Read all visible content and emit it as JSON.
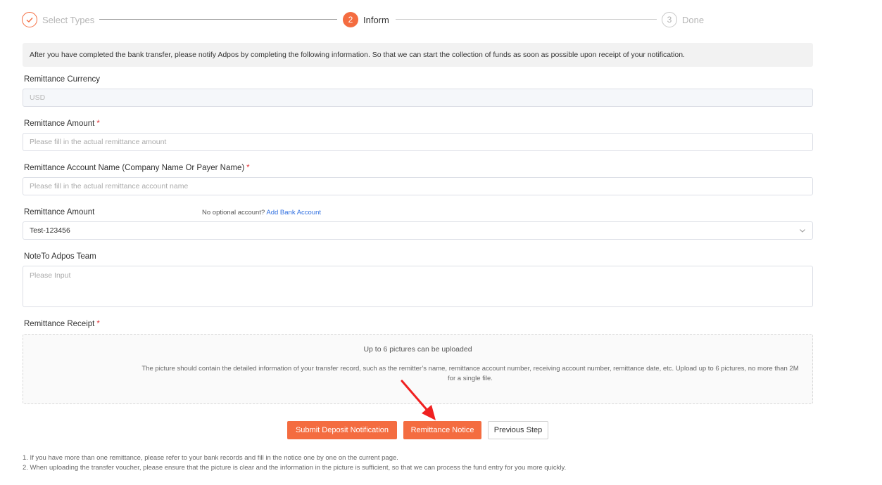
{
  "steps": [
    {
      "number": "1",
      "label": "Select Types",
      "state": "done"
    },
    {
      "number": "2",
      "label": "Inform",
      "state": "active"
    },
    {
      "number": "3",
      "label": "Done",
      "state": "todo"
    }
  ],
  "info_text": "After you have completed the bank transfer, please notify Adpos by completing the following information. So that we can start the collection of funds as soon as possible upon receipt of your notification.",
  "form": {
    "currency_label": "Remittance Currency",
    "currency_value": "USD",
    "amount_label": "Remittance Amount",
    "amount_placeholder": "Please fill in the actual remittance amount",
    "account_name_label": "Remittance Account Name (Company Name Or Payer Name)",
    "account_name_placeholder": "Please fill in the actual remittance account name",
    "account_label": "Remittance Amount",
    "account_helper": "No optional account?",
    "account_helper_link": "Add Bank Account",
    "account_value": "Test-123456",
    "note_label": "NoteTo Adpos Team",
    "note_placeholder": "Please Input",
    "receipt_label": "Remittance Receipt",
    "required_mark": "*"
  },
  "upload": {
    "title": "Up to 6 pictures can be uploaded",
    "description": "The picture should contain the detailed information of your transfer record, such as the remitter’s name, remittance account number, receiving account number, remittance date, etc. Upload up to 6 pictures, no more than 2M for a single file."
  },
  "buttons": {
    "submit": "Submit Deposit Notification",
    "notice": "Remittance Notice",
    "previous": "Previous Step"
  },
  "notes": [
    "1. If you have more than one remittance, please refer to your bank records and fill in the notice one by one on the current page.",
    "2. When uploading the transfer voucher, please ensure that the picture is clear and the information in the picture is sufficient, so that we can process the fund entry for you more quickly."
  ],
  "colors": {
    "accent": "#f46c40",
    "link": "#2f6fe0",
    "required": "#e4393c",
    "annotation_arrow": "#f02020"
  }
}
